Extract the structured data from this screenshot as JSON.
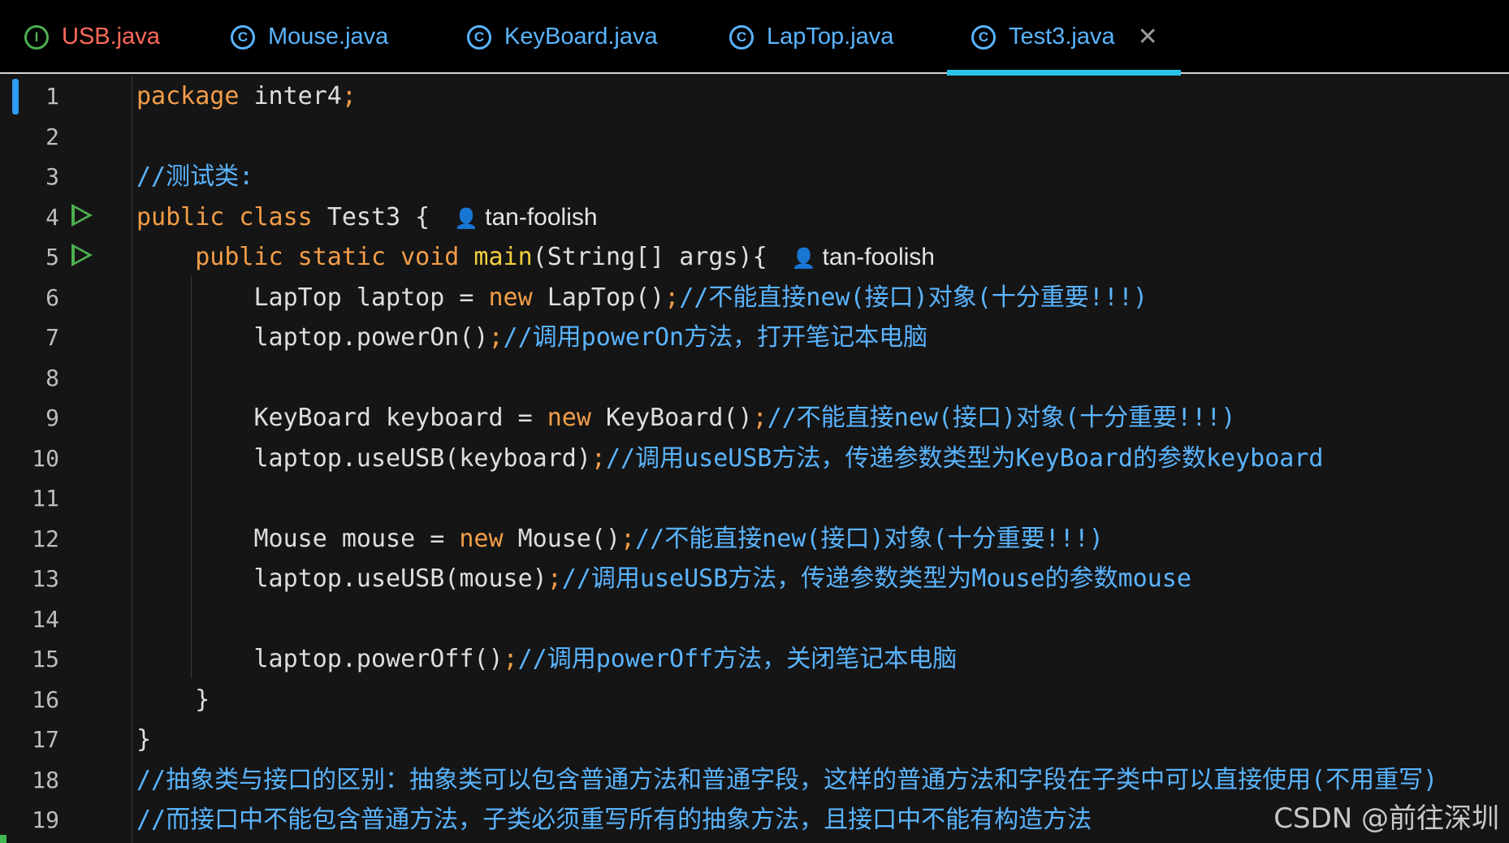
{
  "tabs": [
    {
      "label": "USB.java",
      "icon": "I",
      "color": "#ff6b5b",
      "icon_color": "#4caf50"
    },
    {
      "label": "Mouse.java",
      "icon": "C",
      "color": "#5ab4ff",
      "icon_color": "#5ab4ff"
    },
    {
      "label": "KeyBoard.java",
      "icon": "C",
      "color": "#5ab4ff",
      "icon_color": "#5ab4ff"
    },
    {
      "label": "LapTop.java",
      "icon": "C",
      "color": "#5ab4ff",
      "icon_color": "#5ab4ff"
    },
    {
      "label": "Test3.java",
      "icon": "C",
      "color": "#5ab4ff",
      "icon_color": "#5ab4ff",
      "close": "✕"
    }
  ],
  "author": "tan-foolish",
  "lines": [
    {
      "n": "1",
      "tokens": [
        [
          "kw",
          "package "
        ],
        [
          "pl",
          "inter4"
        ],
        [
          "kw",
          ";"
        ]
      ]
    },
    {
      "n": "2",
      "tokens": []
    },
    {
      "n": "3",
      "tokens": [
        [
          "cm",
          "//测试类:"
        ]
      ]
    },
    {
      "n": "4",
      "run": true,
      "author": true,
      "tokens": [
        [
          "kw",
          "public class "
        ],
        [
          "pl",
          "Test3 {"
        ]
      ]
    },
    {
      "n": "5",
      "run": true,
      "author": true,
      "tokens": [
        [
          "pl",
          "    "
        ],
        [
          "kw",
          "public static void "
        ],
        [
          "fn",
          "main"
        ],
        [
          "pl",
          "(String[] args){"
        ]
      ]
    },
    {
      "n": "6",
      "tokens": [
        [
          "pl",
          "        LapTop laptop = "
        ],
        [
          "kw",
          "new "
        ],
        [
          "pl",
          "LapTop()"
        ],
        [
          "kw",
          ";"
        ],
        [
          "cm",
          "//不能直接new(接口)对象(十分重要!!!)"
        ]
      ]
    },
    {
      "n": "7",
      "tokens": [
        [
          "pl",
          "        laptop.powerOn()"
        ],
        [
          "kw",
          ";"
        ],
        [
          "cm",
          "//调用powerOn方法，打开笔记本电脑"
        ]
      ]
    },
    {
      "n": "8",
      "tokens": []
    },
    {
      "n": "9",
      "tokens": [
        [
          "pl",
          "        KeyBoard keyboard = "
        ],
        [
          "kw",
          "new "
        ],
        [
          "pl",
          "KeyBoard()"
        ],
        [
          "kw",
          ";"
        ],
        [
          "cm",
          "//不能直接new(接口)对象(十分重要!!!)"
        ]
      ]
    },
    {
      "n": "10",
      "tokens": [
        [
          "pl",
          "        laptop.useUSB(keyboard)"
        ],
        [
          "kw",
          ";"
        ],
        [
          "cm",
          "//调用useUSB方法，传递参数类型为KeyBoard的参数keyboard"
        ]
      ]
    },
    {
      "n": "11",
      "tokens": []
    },
    {
      "n": "12",
      "tokens": [
        [
          "pl",
          "        Mouse mouse = "
        ],
        [
          "kw",
          "new "
        ],
        [
          "pl",
          "Mouse()"
        ],
        [
          "kw",
          ";"
        ],
        [
          "cm",
          "//不能直接new(接口)对象(十分重要!!!)"
        ]
      ]
    },
    {
      "n": "13",
      "tokens": [
        [
          "pl",
          "        laptop.useUSB(mouse)"
        ],
        [
          "kw",
          ";"
        ],
        [
          "cm",
          "//调用useUSB方法，传递参数类型为Mouse的参数mouse"
        ]
      ]
    },
    {
      "n": "14",
      "tokens": []
    },
    {
      "n": "15",
      "tokens": [
        [
          "pl",
          "        laptop.powerOff()"
        ],
        [
          "kw",
          ";"
        ],
        [
          "cm",
          "//调用powerOff方法，关闭笔记本电脑"
        ]
      ]
    },
    {
      "n": "16",
      "tokens": [
        [
          "pl",
          "    }"
        ]
      ]
    },
    {
      "n": "17",
      "tokens": [
        [
          "pl",
          "}"
        ]
      ]
    },
    {
      "n": "18",
      "tokens": [
        [
          "cm",
          "//抽象类与接口的区别：抽象类可以包含普通方法和普通字段，这样的普通方法和字段在子类中可以直接使用(不用重写)"
        ]
      ]
    },
    {
      "n": "19",
      "tokens": [
        [
          "cm",
          "//而接口中不能包含普通方法，子类必须重写所有的抽象方法，且接口中不能有构造方法"
        ]
      ]
    }
  ],
  "watermark": "CSDN @前往深圳"
}
